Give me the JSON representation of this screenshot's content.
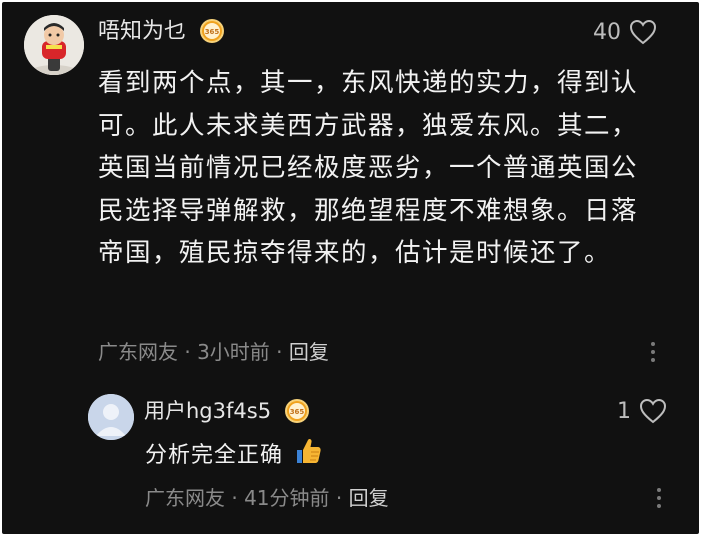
{
  "comment": {
    "username": "唔知为乜",
    "badge_text": "365",
    "like_count": "40",
    "text": "看到两个点，其一，东风快递的实力，得到认可。此人未求美西方武器，独爱东风。其二，英国当前情况已经极度恶劣，一个普通英国公民选择导弹解救，那绝望程度不难想象。日落帝国，殖民掠夺得来的，估计是时候还了。",
    "location": "广东网友",
    "time": "3小时前",
    "reply_label": "回复",
    "separator": "·"
  },
  "reply": {
    "username": "用户hg3f4s5",
    "badge_text": "365",
    "like_count": "1",
    "text": "分析完全正确",
    "location": "广东网友",
    "time": "41分钟前",
    "reply_label": "回复",
    "separator": "·"
  },
  "colors": {
    "background": "#111111",
    "text_primary": "#f2f2f2",
    "text_meta": "#8a8a8a",
    "badge_gold": "#f0a21e"
  },
  "icons": {
    "like": "heart-outline-icon",
    "more": "more-vertical-icon",
    "badge": "level-badge-icon",
    "emoji": "thumbs-up-emoji"
  }
}
